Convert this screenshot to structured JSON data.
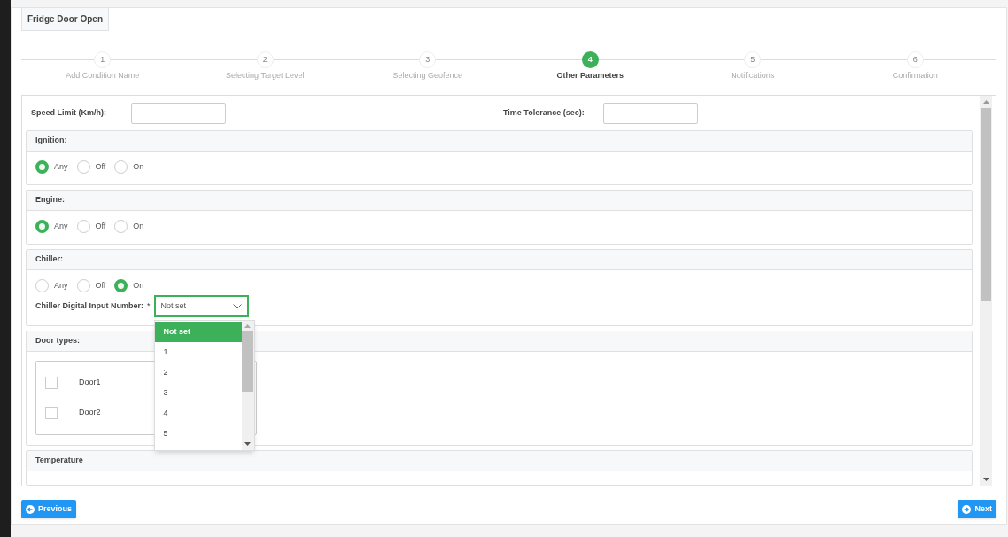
{
  "card_title": "Fridge Door Open",
  "steps": [
    {
      "number": "1",
      "label": "Add Condition Name",
      "selected": false
    },
    {
      "number": "2",
      "label": "Selecting Target Level",
      "selected": false
    },
    {
      "number": "3",
      "label": "Selecting Geofence",
      "selected": false
    },
    {
      "number": "4",
      "label": "Other Parameters",
      "selected": true
    },
    {
      "number": "5",
      "label": "Notifications",
      "selected": false
    },
    {
      "number": "6",
      "label": "Confirmation",
      "selected": false
    }
  ],
  "fields": [
    {
      "label": "Speed Limit (Km/h):"
    },
    {
      "label": "Time Tolerance (sec):"
    }
  ],
  "sections": [
    {
      "title": "Ignition:",
      "kind": "radio",
      "options": [
        {
          "label": "Any",
          "selected": true
        },
        {
          "label": "Off",
          "selected": false
        },
        {
          "label": "On",
          "selected": false
        }
      ]
    },
    {
      "title": "Engine:",
      "kind": "radio",
      "options": [
        {
          "label": "Any",
          "selected": true
        },
        {
          "label": "Off",
          "selected": false
        },
        {
          "label": "On",
          "selected": false
        }
      ]
    },
    {
      "title": "Chiller:",
      "kind": "radio",
      "options": [
        {
          "label": "Any",
          "selected": false
        },
        {
          "label": "Off",
          "selected": false
        },
        {
          "label": "On",
          "selected": true
        }
      ],
      "select": {
        "label": "Chiller Digital Input Number:",
        "required_mark": "*",
        "value": "Not set",
        "expanded": true,
        "options": [
          {
            "label": "Not set",
            "selected": true
          },
          {
            "label": "1",
            "selected": false
          },
          {
            "label": "2",
            "selected": false
          },
          {
            "label": "3",
            "selected": false
          },
          {
            "label": "4",
            "selected": false
          },
          {
            "label": "5",
            "selected": false
          }
        ]
      }
    },
    {
      "title": "Door types:",
      "kind": "checkbox",
      "options": [
        {
          "label": "Door1",
          "checked": false
        },
        {
          "label": "Door2",
          "checked": false
        }
      ]
    },
    {
      "title": "Temperature",
      "kind": "empty"
    }
  ],
  "buttons": {
    "previous": "Previous",
    "next": "Next"
  }
}
